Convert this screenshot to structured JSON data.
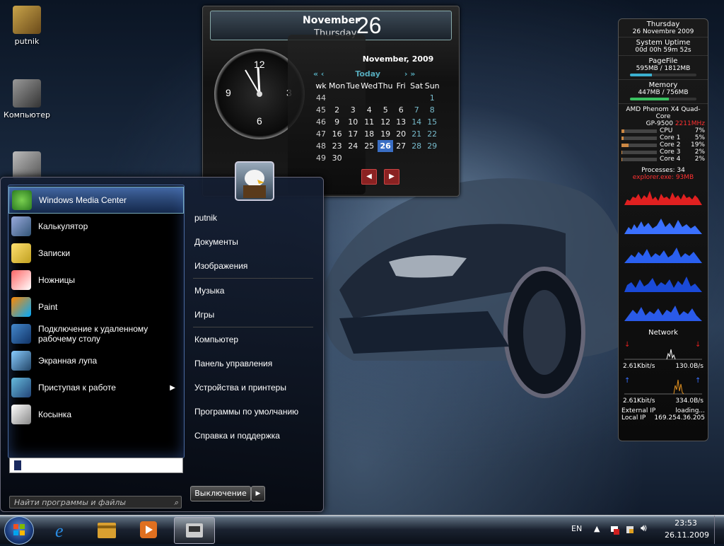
{
  "desktop": {
    "icons": [
      {
        "label": "putnik"
      },
      {
        "label": "Компьютер"
      }
    ]
  },
  "calendar_gadget": {
    "month": "November",
    "weekday": "Thursday",
    "day": "26",
    "grid_title": "November, 2009",
    "today_label": "Today",
    "headers": [
      "wk",
      "Mon",
      "Tue",
      "Wed",
      "Thu",
      "Fri",
      "Sat",
      "Sun"
    ],
    "weeks": [
      [
        "44",
        "",
        "",
        "",
        "",
        "",
        "",
        "1"
      ],
      [
        "45",
        "2",
        "3",
        "4",
        "5",
        "6",
        "7",
        "8"
      ],
      [
        "46",
        "9",
        "10",
        "11",
        "12",
        "13",
        "14",
        "15"
      ],
      [
        "47",
        "16",
        "17",
        "18",
        "19",
        "20",
        "21",
        "22"
      ],
      [
        "48",
        "23",
        "24",
        "25",
        "26",
        "27",
        "28",
        "29"
      ],
      [
        "49",
        "30",
        "",
        "",
        "",
        "",
        "",
        ""
      ]
    ],
    "clock_numbers": [
      "12",
      "3",
      "6",
      "9"
    ]
  },
  "system_monitor": {
    "day": "Thursday",
    "date": "26 Novembre 2009",
    "uptime_label": "System Uptime",
    "uptime_value": "00d 00h 59m 52s",
    "pagefile_label": "PageFile",
    "pagefile_value": "595MB / 1812MB",
    "pagefile_fraction": 0.33,
    "memory_label": "Memory",
    "memory_value": "447MB / 756MB",
    "memory_fraction": 0.59,
    "cpu_name": "AMD Phenom X4 Quad-Core",
    "cpu_model": "GP-9500",
    "cpu_freq": "2211MHz",
    "cores": [
      {
        "label": "CPU",
        "value": "7%",
        "fraction": 0.07
      },
      {
        "label": "Core 1",
        "value": "5%",
        "fraction": 0.05
      },
      {
        "label": "Core 2",
        "value": "19%",
        "fraction": 0.19
      },
      {
        "label": "Core 3",
        "value": "2%",
        "fraction": 0.02
      },
      {
        "label": "Core 4",
        "value": "2%",
        "fraction": 0.02
      }
    ],
    "processes": "Processes: 34",
    "top_process": "explorer.exe: 93MB",
    "network_label": "Network",
    "net1_left": "2.61Kbit/s",
    "net1_right": "130.0B/s",
    "net2_left": "2.61Kbit/s",
    "net2_right": "334.0B/s",
    "external_ip_label": "External IP",
    "external_ip_value": "loading...",
    "local_ip_label": "Local IP",
    "local_ip_value": "169.254.36.205"
  },
  "start_menu": {
    "programs": [
      {
        "label": "Windows Media Center",
        "icon": "windows-media-center-icon",
        "highlighted": true
      },
      {
        "label": "Калькулятор",
        "icon": "calculator-icon"
      },
      {
        "label": "Записки",
        "icon": "sticky-notes-icon"
      },
      {
        "label": "Ножницы",
        "icon": "snipping-tool-icon"
      },
      {
        "label": "Paint",
        "icon": "paint-icon"
      },
      {
        "label": "Подключение к удаленному рабочему столу",
        "icon": "remote-desktop-icon"
      },
      {
        "label": "Экранная лупа",
        "icon": "magnifier-icon"
      },
      {
        "label": "Приступая к работе",
        "icon": "getting-started-icon",
        "has_submenu": true
      },
      {
        "label": "Косынка",
        "icon": "solitaire-icon"
      }
    ],
    "search_placeholder": "Найти программы и файлы",
    "right_items": [
      {
        "label": "putnik"
      },
      {
        "label": "Документы"
      },
      {
        "label": "Изображения"
      },
      {
        "label": "Музыка"
      },
      {
        "label": "Игры"
      },
      {
        "label": "Компьютер"
      },
      {
        "label": "Панель управления"
      },
      {
        "label": "Устройства и принтеры"
      },
      {
        "label": "Программы по умолчанию"
      },
      {
        "label": "Справка и поддержка"
      }
    ],
    "shutdown_label": "Выключение"
  },
  "taskbar": {
    "language": "EN",
    "time": "23:53",
    "date": "26.11.2009"
  },
  "colors": {
    "accent_blue": "#3a6ec4",
    "cpu_freq_red": "#ff3030",
    "graph_red": "#e02020",
    "graph_blue": "#3a70ff"
  }
}
